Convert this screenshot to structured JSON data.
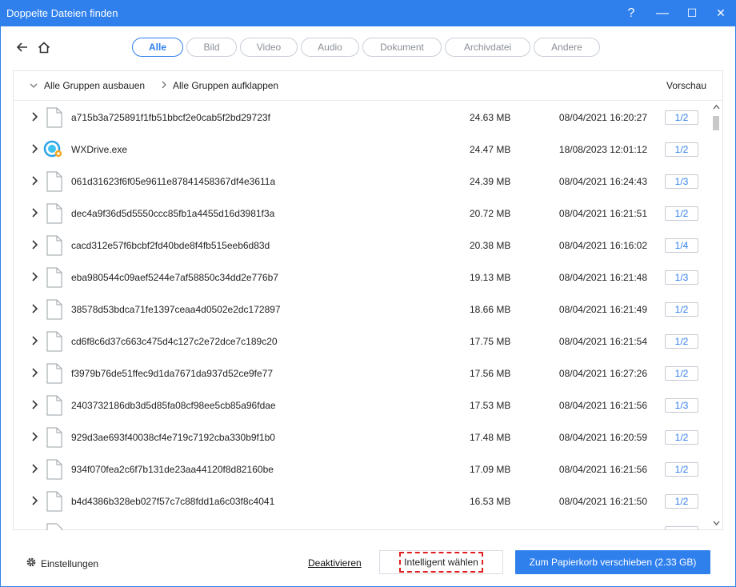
{
  "window": {
    "title": "Doppelte Dateien finden",
    "help": "?",
    "minimize": "—",
    "maximize": "☐",
    "close": "✕"
  },
  "tabs": [
    {
      "label": "Alle",
      "active": true
    },
    {
      "label": "Bild",
      "active": false
    },
    {
      "label": "Video",
      "active": false
    },
    {
      "label": "Audio",
      "active": false
    },
    {
      "label": "Dokument",
      "active": false
    },
    {
      "label": "Archivdatei",
      "active": false
    },
    {
      "label": "Andere",
      "active": false
    }
  ],
  "header": {
    "collapse_all": "Alle Gruppen ausbauen",
    "expand_all": "Alle Gruppen aufklappen",
    "preview": "Vorschau"
  },
  "files": [
    {
      "name": "a715b3a725891f1fb51bbcf2e0cab5f2bd29723f",
      "size": "24.63 MB",
      "date": "08/04/2021 16:20:27",
      "group": "1/2",
      "icon": "document-icon"
    },
    {
      "name": "WXDrive.exe",
      "size": "24.47 MB",
      "date": "18/08/2023 12:01:12",
      "group": "1/2",
      "icon": "wxdrive-app-icon"
    },
    {
      "name": "061d31623f6f05e9611e87841458367df4e3611a",
      "size": "24.39 MB",
      "date": "08/04/2021 16:24:43",
      "group": "1/3",
      "icon": "document-icon"
    },
    {
      "name": "dec4a9f36d5d5550ccc85fb1a4455d16d3981f3a",
      "size": "20.72 MB",
      "date": "08/04/2021 16:21:51",
      "group": "1/2",
      "icon": "document-icon"
    },
    {
      "name": "cacd312e57f6bcbf2fd40bde8f4fb515eeb6d83d",
      "size": "20.38 MB",
      "date": "08/04/2021 16:16:02",
      "group": "1/4",
      "icon": "document-icon"
    },
    {
      "name": "eba980544c09aef5244e7af58850c34dd2e776b7",
      "size": "19.13 MB",
      "date": "08/04/2021 16:21:48",
      "group": "1/3",
      "icon": "document-icon"
    },
    {
      "name": "38578d53bdca71fe1397ceaa4d0502e2dc172897",
      "size": "18.66 MB",
      "date": "08/04/2021 16:21:49",
      "group": "1/2",
      "icon": "document-icon"
    },
    {
      "name": "cd6f8c6d37c663c475d4c127c2e72dce7c189c20",
      "size": "17.75 MB",
      "date": "08/04/2021 16:21:54",
      "group": "1/2",
      "icon": "document-icon"
    },
    {
      "name": "f3979b76de51ffec9d1da7671da937d52ce9fe77",
      "size": "17.56 MB",
      "date": "08/04/2021 16:27:26",
      "group": "1/2",
      "icon": "document-icon"
    },
    {
      "name": "2403732186db3d5d85fa08cf98ee5cb85a96fdae",
      "size": "17.53 MB",
      "date": "08/04/2021 16:21:56",
      "group": "1/3",
      "icon": "document-icon"
    },
    {
      "name": "929d3ae693f40038cf4e719c7192cba330b9f1b0",
      "size": "17.48 MB",
      "date": "08/04/2021 16:20:59",
      "group": "1/2",
      "icon": "document-icon"
    },
    {
      "name": "934f070fea2c6f7b131de23aa44120f8d82160be",
      "size": "17.09 MB",
      "date": "08/04/2021 16:21:56",
      "group": "1/2",
      "icon": "document-icon"
    },
    {
      "name": "b4d4386b328eb027f57c7c88fdd1a6c03f8c4041",
      "size": "16.53 MB",
      "date": "08/04/2021 16:21:50",
      "group": "1/2",
      "icon": "document-icon"
    }
  ],
  "footer": {
    "settings": "Einstellungen",
    "deactivate": "Deaktivieren",
    "smart_select": "Intelligent wählen",
    "move_to_trash": "Zum Papierkorb verschieben (2.33 GB)"
  },
  "colors": {
    "accent": "#2f80ed",
    "highlight": "#e02020"
  }
}
